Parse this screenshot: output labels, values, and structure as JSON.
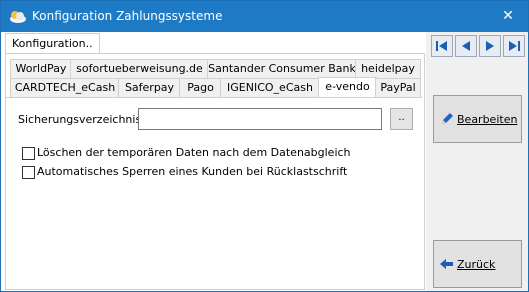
{
  "window": {
    "title": "Konfiguration Zahlungssysteme",
    "close_label": "✕"
  },
  "outer_tab": {
    "label": "Konfiguration.."
  },
  "tabs_row1": [
    "WorldPay",
    "sofortueberweisung.de",
    "Santander Consumer Bank",
    "heidelpay"
  ],
  "tabs_row2": [
    "CARDTECH_eCash",
    "Saferpay",
    "Pago",
    "IGENICO_eCash",
    "e-vendo",
    "PayPal"
  ],
  "active_tab": "e-vendo",
  "form": {
    "backup_dir_label": "Sicherungsverzeichnis:",
    "backup_dir_value": "",
    "browse_label": "..",
    "checkbox_delete_temp": {
      "label": "Löschen der temporären Daten nach dem Datenabgleich",
      "checked": false
    },
    "checkbox_auto_block": {
      "label": "Automatisches Sperren eines Kunden bei Rücklastschrift",
      "checked": false
    }
  },
  "right": {
    "nav_icons": [
      "first-record-icon",
      "previous-record-icon",
      "next-record-icon",
      "last-record-icon"
    ],
    "edit_label": "Bearbeiten",
    "back_label": "Zurück"
  },
  "colors": {
    "titlebar": "#1f7ac5",
    "nav_arrow": "#1a5fb4"
  }
}
